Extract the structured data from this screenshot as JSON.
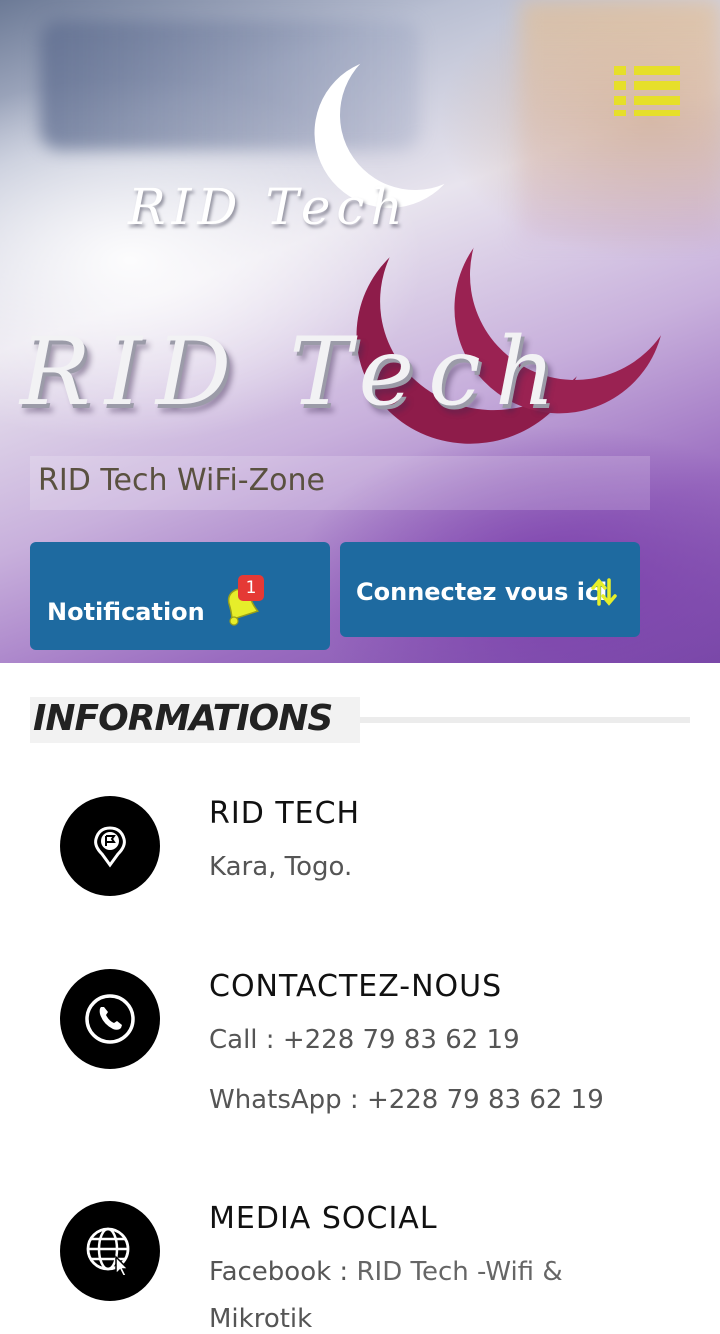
{
  "hero": {
    "logo_small": "RID Tech",
    "logo_big": "RID Tech",
    "zone_title": "RID Tech WiFi-Zone",
    "notification_label": "Notification",
    "notification_count": "1",
    "connect_label": "Connectez vous ici",
    "colors": {
      "button": "#1e6aa0",
      "menu": "#e6df2a",
      "badge": "#e53935",
      "logo_red": "#8e1c4a"
    }
  },
  "info": {
    "title": "INFORMATIONS",
    "items": [
      {
        "icon": "map-pin-icon",
        "title": "RID TECH",
        "lines": [
          "Kara, Togo."
        ]
      },
      {
        "icon": "phone-icon",
        "title": "CONTACTEZ-NOUS",
        "lines": [
          "Call : +228 79 83 62 19",
          "WhatsApp : +228 79 83 62 19"
        ]
      },
      {
        "icon": "globe-cursor-icon",
        "title": "MEDIA SOCIAL",
        "facebook_label": "Facebook : ",
        "facebook_value": "RID Tech -Wifi &",
        "facebook_value_2": "Mikrotik"
      }
    ]
  }
}
